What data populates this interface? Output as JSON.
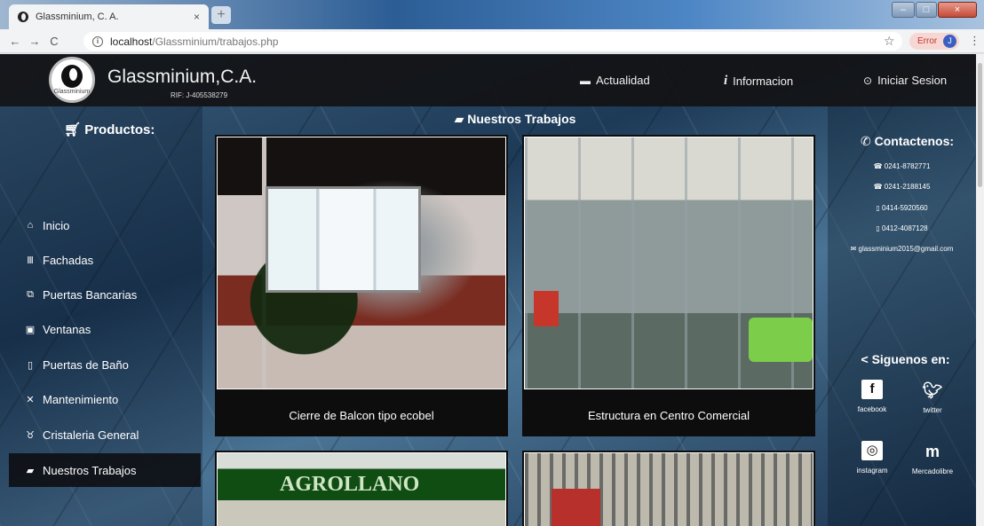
{
  "browser": {
    "tab_title": "Glassminium, C. A.",
    "tab_close": "×",
    "new_tab": "+",
    "url_host": "localhost",
    "url_path": "/Glassminium/trabajos.php",
    "error_label": "Error",
    "avatar_letter": "J"
  },
  "header": {
    "logo_text": "Glassminium",
    "brand": "Glassminium,C.A.",
    "rif": "RIF: J-405538279",
    "nav": {
      "actualidad": "Actualidad",
      "informacion": "Informacion",
      "iniciar": "Iniciar Sesion"
    }
  },
  "sidebar": {
    "title": "Productos:",
    "items": [
      {
        "label": "Inicio",
        "icon": "home-icon"
      },
      {
        "label": "Fachadas",
        "icon": "columns-icon"
      },
      {
        "label": "Puertas Bancarias",
        "icon": "doors-icon"
      },
      {
        "label": "Ventanas",
        "icon": "window-icon"
      },
      {
        "label": "Puertas de Baño",
        "icon": "door-icon"
      },
      {
        "label": "Mantenimiento",
        "icon": "tools-icon"
      },
      {
        "label": "Cristaleria General",
        "icon": "glasses-icon"
      },
      {
        "label": "Nuestros Trabajos",
        "icon": "briefcase-icon"
      }
    ]
  },
  "content": {
    "title": "Nuestros Trabajos",
    "cards": [
      {
        "caption": "Cierre de Balcon tipo ecobel"
      },
      {
        "caption": "Estructura en Centro Comercial"
      },
      {
        "sign_text": "AGROLLANO"
      }
    ]
  },
  "contact": {
    "title": "Contactenos:",
    "lines": [
      "0241-8782771",
      "0241-2188145",
      "0414-5920560",
      "0412-4087128",
      "glassminium2015@gmail.com"
    ],
    "follow_title": "Siguenos en:",
    "social": [
      "facebook",
      "twitter",
      "instagram",
      "Mercadolibre"
    ]
  },
  "colors": {
    "header_bg": "#141416",
    "active_item": "#0c0c10",
    "error_bg": "#f6d7d4",
    "accent": "#3b5fc0"
  }
}
